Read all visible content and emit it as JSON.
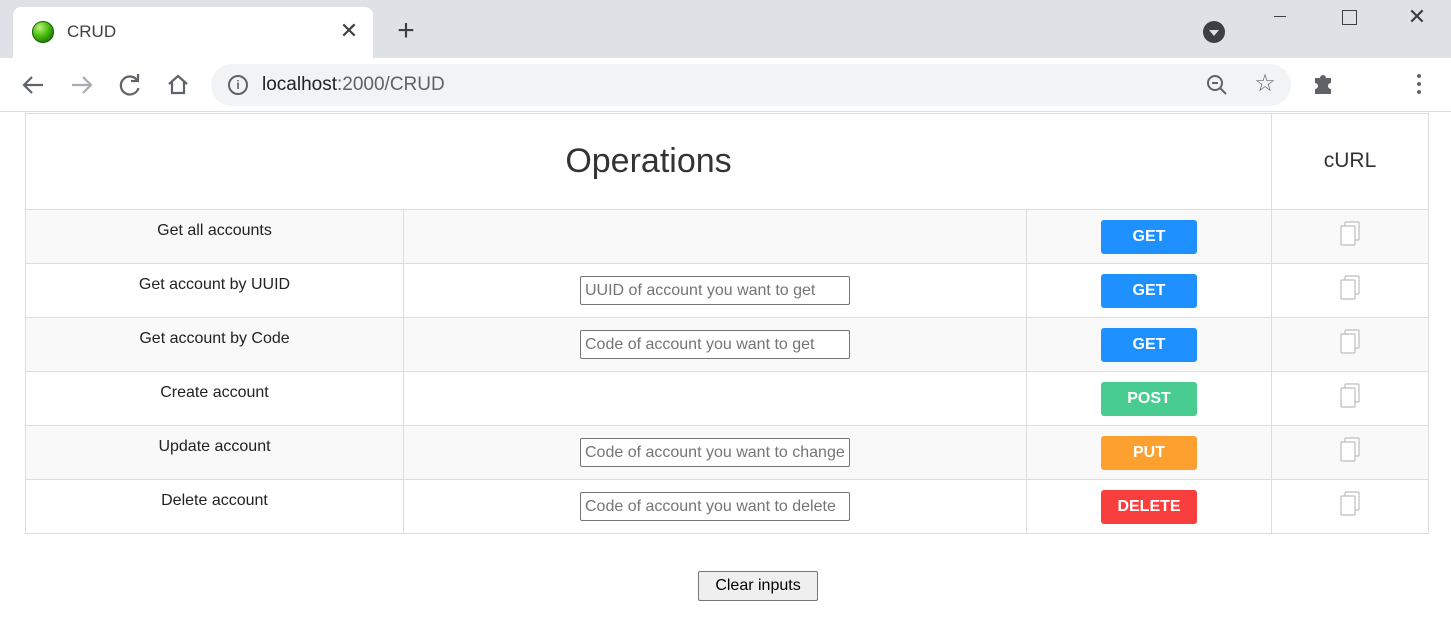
{
  "browser": {
    "tab_title": "CRUD",
    "url_host": "localhost",
    "url_path": ":2000/CRUD",
    "new_tab_symbol": "+",
    "close_symbol": "✕"
  },
  "table": {
    "operations_header": "Operations",
    "curl_header": "cURL",
    "rows": [
      {
        "label": "Get all accounts",
        "placeholder": "",
        "method": "GET",
        "method_color": "#1e90ff"
      },
      {
        "label": "Get account by UUID",
        "placeholder": "UUID of account you want to get",
        "method": "GET",
        "method_color": "#1e90ff"
      },
      {
        "label": "Get account by Code",
        "placeholder": "Code of account you want to get",
        "method": "GET",
        "method_color": "#1e90ff"
      },
      {
        "label": "Create account",
        "placeholder": "",
        "method": "POST",
        "method_color": "#49cc90"
      },
      {
        "label": "Update account",
        "placeholder": "Code of account you want to change",
        "method": "PUT",
        "method_color": "#fca130"
      },
      {
        "label": "Delete account",
        "placeholder": "Code of account you want to delete",
        "method": "DELETE",
        "method_color": "#f93e3e"
      }
    ]
  },
  "clear_button_label": "Clear inputs",
  "icons": {
    "favicon": "green-orb-icon",
    "copy": "copy-icon"
  }
}
